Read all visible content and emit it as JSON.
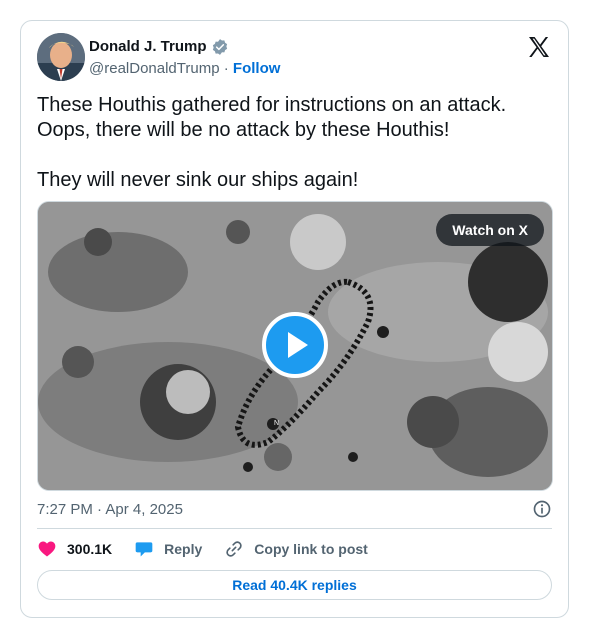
{
  "author": {
    "name": "Donald J. Trump",
    "handle": "@realDonaldTrump",
    "separator": "·",
    "follow_label": "Follow",
    "verified_badge": "verified-badge-icon"
  },
  "tweet": {
    "line1": "These Houthis gathered for instructions on an attack.",
    "line2": "Oops, there will be no attack by these Houthis!",
    "line3": "They will never sink our ships again!"
  },
  "media": {
    "watch_label": "Watch on X",
    "play_icon": "play-icon",
    "overlay_marker": "N"
  },
  "meta": {
    "time": "7:27 PM",
    "separator": "·",
    "date": "Apr 4, 2025",
    "info_icon": "info-icon"
  },
  "actions": {
    "like_count": "300.1K",
    "reply_label": "Reply",
    "copy_label": "Copy link to post"
  },
  "footer": {
    "replies_label": "Read 40.4K replies"
  },
  "colors": {
    "accent": "#1d9bf0",
    "link": "#006fd6",
    "like": "#f91880",
    "muted": "#536471",
    "border": "#cfd9de"
  }
}
